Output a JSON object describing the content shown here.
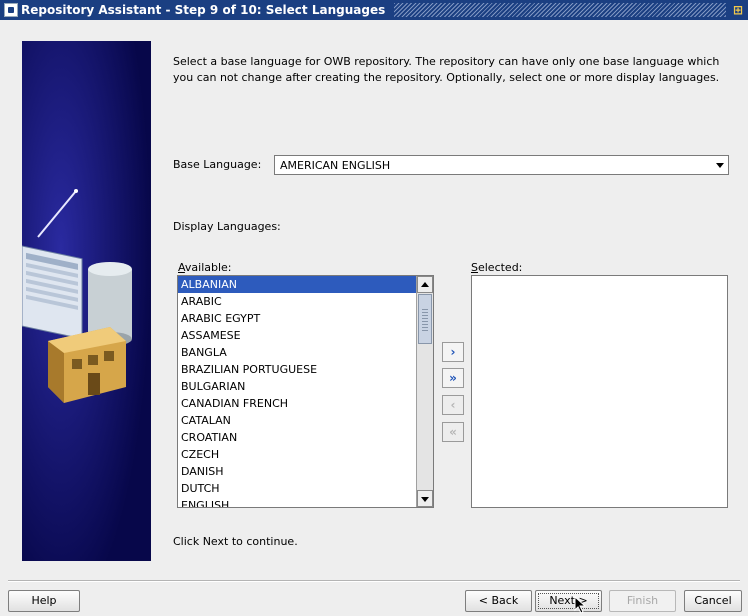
{
  "window": {
    "title": "Repository Assistant - Step 9 of 10: Select Languages",
    "corner_glyph": "⊞"
  },
  "instructions": "Select a base language for OWB repository. The repository can have only one base language which you can not change after creating the repository.  Optionally, select one or more display languages.",
  "base_language": {
    "label": "Base Language:",
    "value": "AMERICAN ENGLISH"
  },
  "display_languages": {
    "label": "Display Languages:",
    "available_label": "Available:",
    "selected_label": "Selected:",
    "available": [
      "ALBANIAN",
      "ARABIC",
      "ARABIC EGYPT",
      "ASSAMESE",
      "BANGLA",
      "BRAZILIAN PORTUGUESE",
      "BULGARIAN",
      "CANADIAN FRENCH",
      "CATALAN",
      "CROATIAN",
      "CZECH",
      "DANISH",
      "DUTCH",
      "ENGLISH"
    ],
    "selected": [],
    "highlighted": "ALBANIAN"
  },
  "move_buttons": {
    "add": "›",
    "add_all": "»",
    "remove": "‹",
    "remove_all": "«"
  },
  "footer_text": "Click Next to continue.",
  "buttons": {
    "help": "Help",
    "back": "< Back",
    "next": "Next >",
    "finish": "Finish",
    "cancel": "Cancel"
  },
  "colors": {
    "titlebar": "#1b3f82",
    "selection": "#2d5bbd",
    "side_image": "#10106a"
  }
}
